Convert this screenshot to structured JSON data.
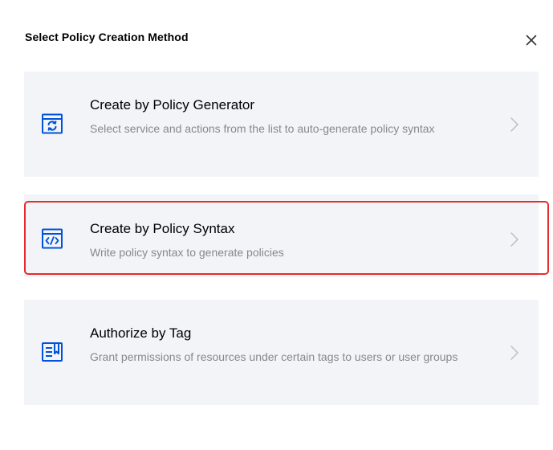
{
  "dialog": {
    "title": "Select Policy Creation Method"
  },
  "options": [
    {
      "title": "Create by Policy Generator",
      "description": "Select service and actions from the list to auto-generate policy syntax",
      "icon": "policy-generator-icon",
      "selected": false
    },
    {
      "title": "Create by Policy Syntax",
      "description": "Write policy syntax to generate policies",
      "icon": "code-syntax-icon",
      "selected": true
    },
    {
      "title": "Authorize by Tag",
      "description": "Grant permissions of resources under certain tags to users or user groups",
      "icon": "tag-document-icon",
      "selected": false
    }
  ],
  "colors": {
    "accent": "#0052d9",
    "card_background": "#f2f4f8",
    "highlight_border": "#e62b2b",
    "description_text": "#888888",
    "arrow": "#b8bcc4"
  }
}
